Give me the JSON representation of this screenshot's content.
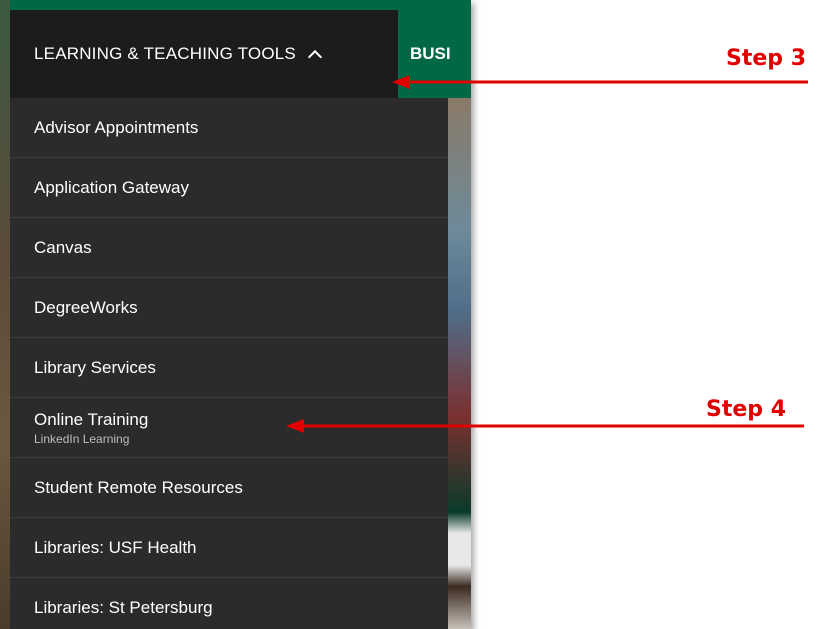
{
  "nav": {
    "active_label": "LEARNING & TEACHING TOOLS",
    "next_label": "BUSI"
  },
  "menu": {
    "items": [
      {
        "label": "Advisor Appointments",
        "sub": ""
      },
      {
        "label": "Application Gateway",
        "sub": ""
      },
      {
        "label": "Canvas",
        "sub": ""
      },
      {
        "label": "DegreeWorks",
        "sub": ""
      },
      {
        "label": "Library Services",
        "sub": ""
      },
      {
        "label": "Online Training",
        "sub": "LinkedIn Learning"
      },
      {
        "label": "Student Remote Resources",
        "sub": ""
      },
      {
        "label": "Libraries: USF Health",
        "sub": ""
      },
      {
        "label": "Libraries: St Petersburg",
        "sub": ""
      }
    ]
  },
  "annotations": {
    "step3": "Step 3",
    "step4": "Step 4"
  },
  "colors": {
    "brand_green": "#006747",
    "menu_bg": "#2b2b2b",
    "active_bg": "#1c1c1c",
    "annotation_red": "#e00000"
  }
}
